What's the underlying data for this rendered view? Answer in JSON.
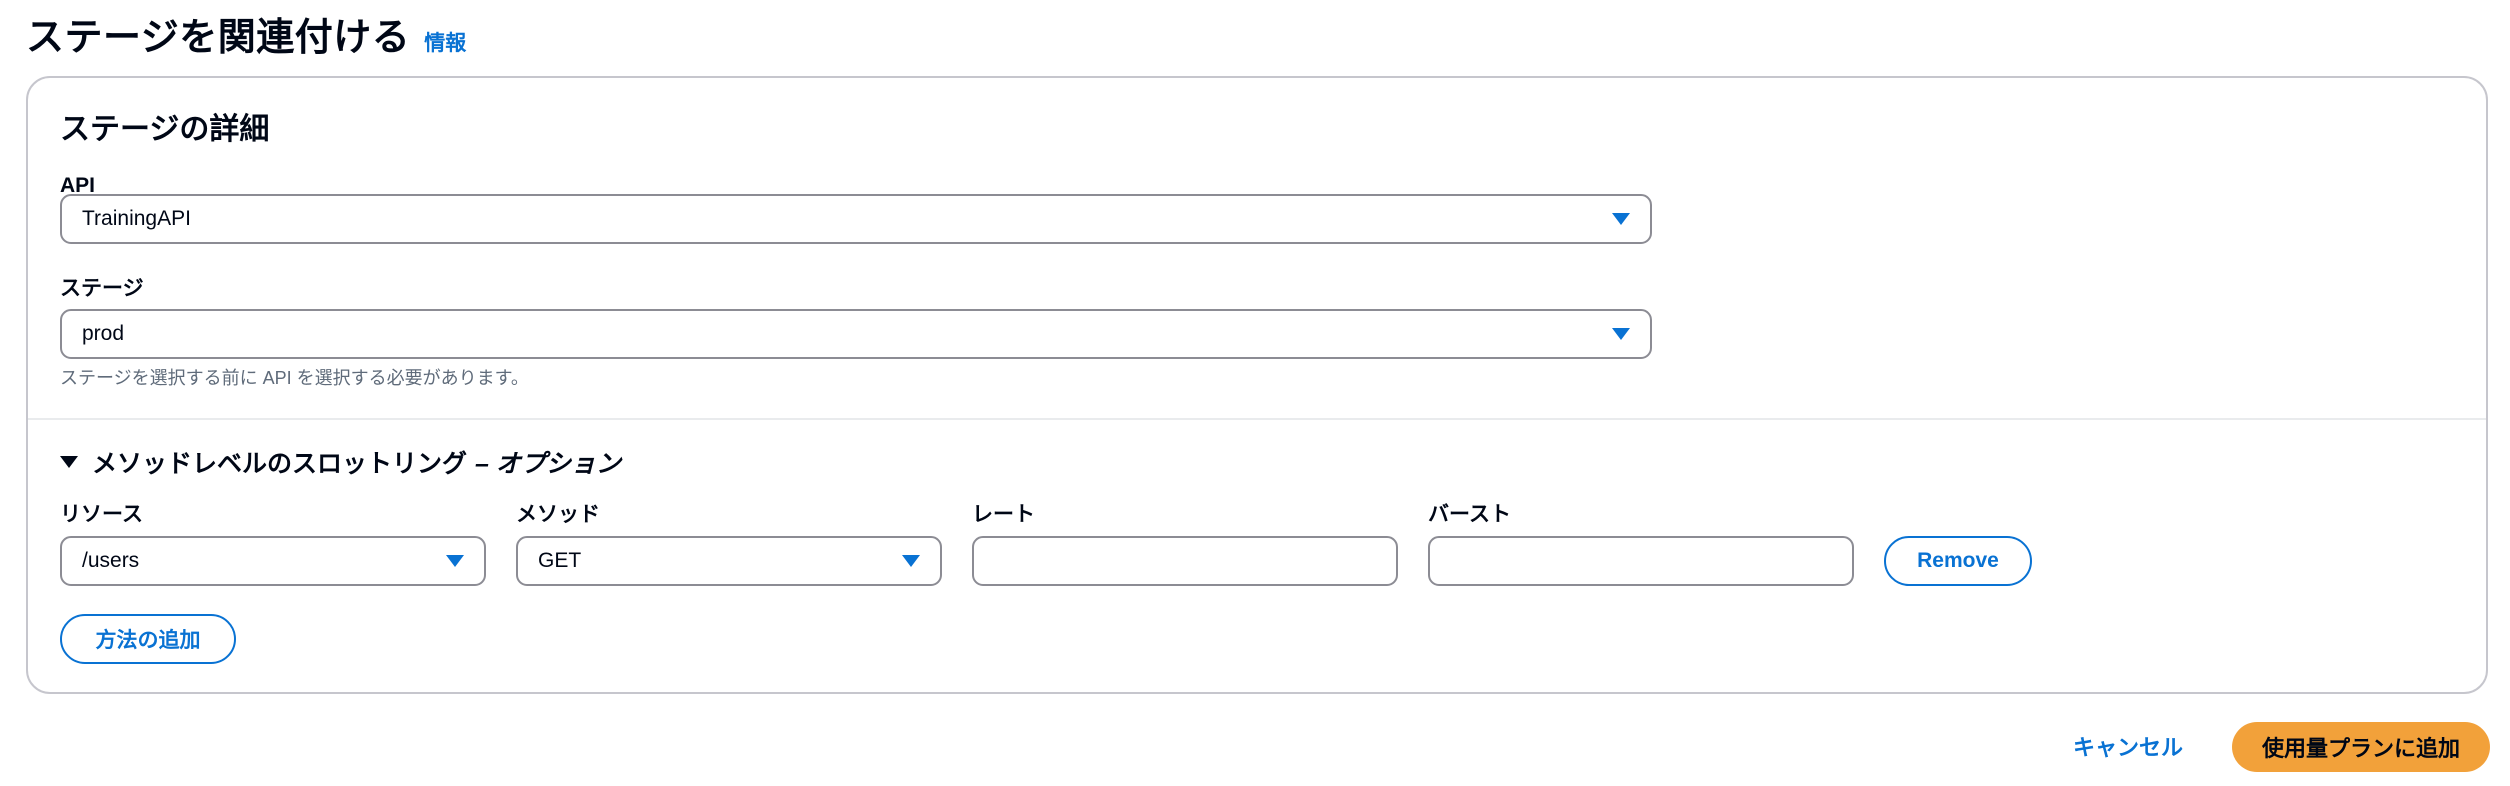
{
  "header": {
    "title": "ステージを関連付ける",
    "info_link": "情報"
  },
  "stage_details": {
    "title": "ステージの詳細",
    "api": {
      "label": "API",
      "value": "TrainingAPI"
    },
    "stage": {
      "label": "ステージ",
      "value": "prod",
      "hint": "ステージを選択する前に API を選択する必要があります。"
    }
  },
  "throttling": {
    "title": "メソッドレベルのスロットリング",
    "suffix": "– オプション",
    "resource": {
      "label": "リソース",
      "value": "/users"
    },
    "method": {
      "label": "メソッド",
      "value": "GET"
    },
    "rate": {
      "label": "レート",
      "value": ""
    },
    "burst": {
      "label": "バースト",
      "value": ""
    },
    "remove_label": "Remove",
    "add_method_label": "方法の追加"
  },
  "footer": {
    "cancel_label": "キャンセル",
    "submit_label": "使用量プランに追加"
  },
  "colors": {
    "link_blue": "#0972d3",
    "primary_orange": "#f2a13a",
    "border_gray": "#8c8c94"
  }
}
